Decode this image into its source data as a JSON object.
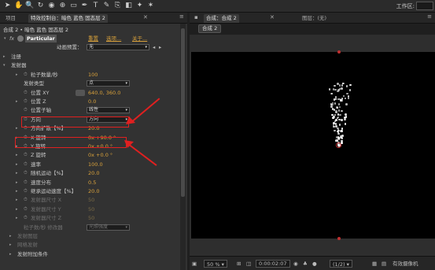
{
  "toolbar": {
    "tools": [
      "selection-tool-icon",
      "hand-tool-icon",
      "zoom-tool-icon",
      "rotate-tool-icon",
      "camera-tool-icon",
      "pan-behind-tool-icon",
      "rectangle-tool-icon",
      "pen-tool-icon",
      "text-tool-icon",
      "brush-tool-icon",
      "clone-tool-icon",
      "eraser-tool-icon",
      "roto-tool-icon",
      "puppet-tool-icon"
    ],
    "workspace_label": "工作区:"
  },
  "left_tabs": [
    "项目",
    "特效控制台：暗色 蓝色 固态层 2"
  ],
  "layer_path": "合成 2 • 暗色 蓝色 固态层 2",
  "effect": {
    "name": "Particular",
    "links": [
      "重置",
      "选项...",
      "关于..."
    ],
    "preset_label": "动画预置：",
    "preset_value": "无"
  },
  "rows": [
    {
      "label": "注册",
      "indent": 1,
      "twirl": "▸"
    },
    {
      "label": "发射器",
      "indent": 1,
      "twirl": "▾"
    },
    {
      "label": "粒子数量/秒",
      "indent": 3,
      "twirl": "▸",
      "value": "100",
      "stopwatch": true
    },
    {
      "label": "发射类型",
      "indent": 3,
      "dropdown": "点"
    },
    {
      "label": "位置 XY",
      "indent": 3,
      "stopwatch": true,
      "value": "640.0, 360.0",
      "crosshair": true
    },
    {
      "label": "位置 Z",
      "indent": 3,
      "twirl": "▸",
      "value": "0.0",
      "stopwatch": true
    },
    {
      "label": "位置子轴",
      "indent": 3,
      "stopwatch": true,
      "dropdown": "线性"
    },
    {
      "label": "方向",
      "indent": 3,
      "stopwatch": true,
      "dropdown": "方向"
    },
    {
      "label": "方向扩散【%】",
      "indent": 3,
      "twirl": "▸",
      "value": "20.0",
      "stopwatch": true
    },
    {
      "label": "X 旋转",
      "indent": 3,
      "twirl": "▸",
      "value": "0x +90.0 °",
      "stopwatch": true
    },
    {
      "label": "Y 旋转",
      "indent": 3,
      "twirl": "▸",
      "value": "0x +0.0 °",
      "stopwatch": true
    },
    {
      "label": "Z 旋转",
      "indent": 3,
      "twirl": "▸",
      "value": "0x +0.0 °",
      "stopwatch": true
    },
    {
      "label": "速率",
      "indent": 3,
      "twirl": "▸",
      "value": "100.0",
      "stopwatch": true
    },
    {
      "label": "随机运动【%】",
      "indent": 3,
      "twirl": "▸",
      "value": "20.0",
      "stopwatch": true
    },
    {
      "label": "速度分布",
      "indent": 3,
      "twirl": "▸",
      "value": "0.5",
      "stopwatch": true
    },
    {
      "label": "继承运动速度【%】",
      "indent": 3,
      "twirl": "▸",
      "value": "20.0",
      "stopwatch": true
    },
    {
      "label": "发射器尺寸 X",
      "indent": 3,
      "twirl": "▸",
      "value": "50",
      "stopwatch": true,
      "dim": true
    },
    {
      "label": "发射器尺寸 Y",
      "indent": 3,
      "twirl": "▸",
      "value": "50",
      "stopwatch": true,
      "dim": true
    },
    {
      "label": "发射器尺寸 Z",
      "indent": 3,
      "twirl": "▸",
      "value": "50",
      "stopwatch": true,
      "dim": true
    },
    {
      "label": "粒子数/秒 修改器",
      "indent": 3,
      "dropdown": "光照强度",
      "dim": true
    },
    {
      "label": "发射图层",
      "indent": 2,
      "twirl": "▸",
      "dim": true
    },
    {
      "label": "网格发射",
      "indent": 2,
      "twirl": "▸",
      "dim": true
    },
    {
      "label": "发射附加条件",
      "indent": 2,
      "twirl": "▸"
    }
  ],
  "right_tabs": [
    "合成：合成 2",
    "图层：(无)"
  ],
  "comp_subtab": "合成 2",
  "bottom_bar": {
    "zoom": "50 %",
    "timecode": "0:00:02:07",
    "resolution": "(1/2)",
    "camera": "有效摄像机"
  },
  "colors": {
    "panel_bg": "#323232",
    "value_orange": "#d9a13b",
    "annotation_red": "#e02020",
    "canvas_black": "#000000"
  }
}
